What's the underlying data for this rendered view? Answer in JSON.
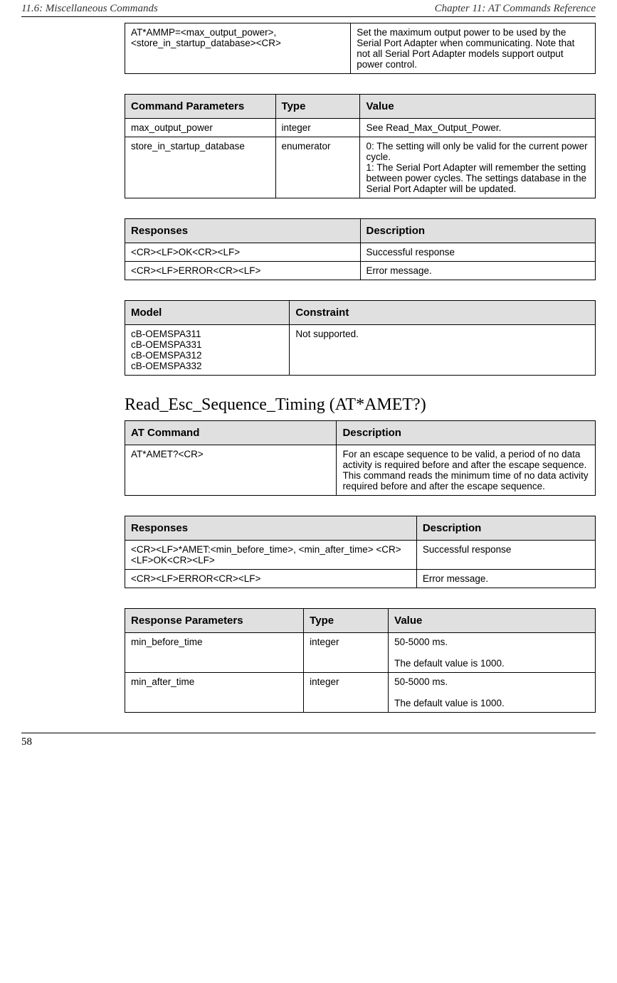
{
  "header": {
    "left": "11.6: Miscellaneous Commands",
    "right": "Chapter 11: AT Commands Reference"
  },
  "footer": {
    "page": "58"
  },
  "tables": {
    "t1": {
      "r0c0": "AT*AMMP=<max_output_power>, <store_in_startup_database><CR>",
      "r0c1": "Set the maximum output power to be used by the Serial Port Adapter when communicating. Note that not all Serial Port Adapter models support output power control."
    },
    "t2": {
      "h0": "Command Parameters",
      "h1": "Type",
      "h2": "Value",
      "r0c0": "max_output_power",
      "r0c1": "integer",
      "r0c2": "See Read_Max_Output_Power.",
      "r1c0": "store_in_startup_database",
      "r1c1": "enumerator",
      "r1c2": "0: The setting will only be valid for the current power cycle.\n1: The Serial Port Adapter will remember the setting between power cycles. The settings database in the Serial Port Adapter will be updated."
    },
    "t3": {
      "h0": "Responses",
      "h1": "Description",
      "r0c0": "<CR><LF>OK<CR><LF>",
      "r0c1": "Successful response",
      "r1c0": "<CR><LF>ERROR<CR><LF>",
      "r1c1": "Error message."
    },
    "t4": {
      "h0": "Model",
      "h1": "Constraint",
      "r0c0": "cB-OEMSPA311\ncB-OEMSPA331\ncB-OEMSPA312\ncB-OEMSPA332",
      "r0c1": "Not supported."
    },
    "section_heading": "Read_Esc_Sequence_Timing (AT*AMET?)",
    "t5": {
      "h0": "AT Command",
      "h1": "Description",
      "r0c0": "AT*AMET?<CR>",
      "r0c1": "For an escape sequence to be valid, a period of no data activity is required before and after the escape sequence. This command reads the minimum time of no data activity required before and after the escape sequence."
    },
    "t6": {
      "h0": "Responses",
      "h1": "Description",
      "r0c0": "<CR><LF>*AMET:<min_before_time>, <min_after_time> <CR><LF>OK<CR><LF>",
      "r0c1": "Successful response",
      "r1c0": "<CR><LF>ERROR<CR><LF>",
      "r1c1": "Error message."
    },
    "t7": {
      "h0": "Response Parameters",
      "h1": "Type",
      "h2": "Value",
      "r0c0": "min_before_time",
      "r0c1": "integer",
      "r0c2": "50-5000 ms.\n\nThe default value is 1000.",
      "r1c0": "min_after_time",
      "r1c1": "integer",
      "r1c2": "50-5000 ms.\n\nThe default value is 1000."
    }
  }
}
